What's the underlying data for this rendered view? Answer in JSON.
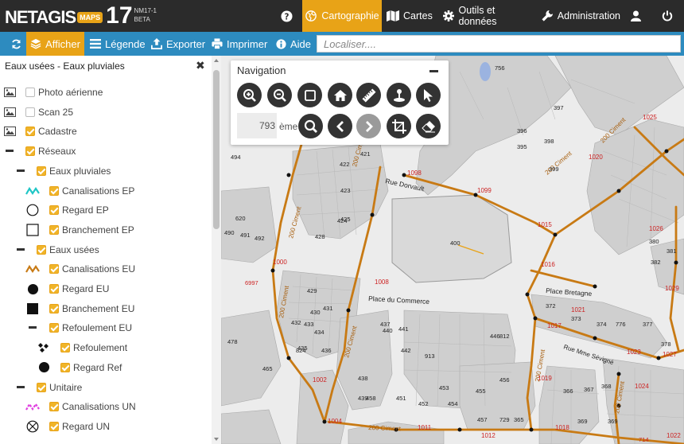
{
  "app": {
    "logo_text": "NETAGIS",
    "logo_badge": "MAPS",
    "logo_version": "17",
    "build": "NM17-1",
    "beta": "BETA"
  },
  "topnav": {
    "help_icon": "question-circle-icon",
    "cartographie": "Cartographie",
    "cartes": "Cartes",
    "outils": "Outils et données",
    "administration": "Administration",
    "user_icon": "user-icon",
    "power_icon": "power-icon"
  },
  "toolbar": {
    "afficher": "Afficher",
    "legende": "Légende",
    "exporter": "Exporter",
    "imprimer": "Imprimer",
    "aide": "Aide",
    "search_placeholder": "Localiser...."
  },
  "sidebar": {
    "title": "Eaux usées - Eaux pluviales",
    "items": [
      {
        "label": "Photo aérienne",
        "checked": false,
        "level": 0,
        "symbol": "image-icon"
      },
      {
        "label": "Scan 25",
        "checked": false,
        "level": 0,
        "symbol": "image-icon"
      },
      {
        "label": "Cadastre",
        "checked": true,
        "level": 0,
        "symbol": "image-icon"
      },
      {
        "label": "Réseaux",
        "checked": true,
        "level": 0,
        "symbol": "collapse-icon"
      },
      {
        "label": "Eaux pluviales",
        "checked": true,
        "level": 1,
        "symbol": "collapse-icon"
      },
      {
        "label": "Canalisations EP",
        "checked": true,
        "level": 2,
        "symbol": "cyan-line-icon"
      },
      {
        "label": "Regard EP",
        "checked": true,
        "level": 2,
        "symbol": "circle-outline-icon"
      },
      {
        "label": "Branchement EP",
        "checked": true,
        "level": 2,
        "symbol": "square-outline-icon"
      },
      {
        "label": "Eaux usées",
        "checked": true,
        "level": 1,
        "symbol": "collapse-icon"
      },
      {
        "label": "Canalisations EU",
        "checked": true,
        "level": 2,
        "symbol": "orange-line-icon"
      },
      {
        "label": "Regard EU",
        "checked": true,
        "level": 2,
        "symbol": "circle-filled-icon"
      },
      {
        "label": "Branchement EU",
        "checked": true,
        "level": 2,
        "symbol": "square-filled-icon"
      },
      {
        "label": "Refoulement EU",
        "checked": true,
        "level": 2,
        "symbol": "collapse-icon"
      },
      {
        "label": "Refoulement",
        "checked": true,
        "level": 3,
        "symbol": "diamonds-icon"
      },
      {
        "label": "Regard Ref",
        "checked": true,
        "level": 3,
        "symbol": "circle-filled-icon"
      },
      {
        "label": "Unitaire",
        "checked": true,
        "level": 1,
        "symbol": "collapse-icon"
      },
      {
        "label": "Canalisations UN",
        "checked": true,
        "level": 2,
        "symbol": "magenta-line-icon"
      },
      {
        "label": "Regard UN",
        "checked": true,
        "level": 2,
        "symbol": "circle-x-icon"
      }
    ]
  },
  "navigation": {
    "title": "Navigation",
    "scale_value": "793",
    "scale_unit": "ème",
    "buttons_row1": [
      "zoom-in-icon",
      "zoom-out-icon",
      "zoom-box-icon",
      "home-icon",
      "measure-icon",
      "locate-icon",
      "pointer-icon"
    ],
    "buttons_row2": [
      "scale-search-icon",
      "previous-icon",
      "next-icon",
      "crop-icon",
      "eraser-icon"
    ]
  },
  "map": {
    "streets": [
      "Rue Dorvault",
      "Place du Commerce",
      "Place Bretagne",
      "Rue Mme Sévigné"
    ],
    "pipe_labels": [
      "200 Ciment",
      "200 Ciment",
      "200 Ciment",
      "200 Ciment",
      "200 Ciment",
      "200 Ciment",
      "200 Ciment",
      "200 Ciment",
      "200 Ciment"
    ],
    "node_labels": [
      "1098",
      "1099",
      "1025",
      "1020",
      "1015",
      "1026",
      "1016",
      "1000",
      "1008",
      "1017",
      "1023",
      "1027",
      "1002",
      "1004",
      "1011",
      "1012",
      "1018",
      "1024",
      "1029",
      "1021",
      "1019",
      "1022"
    ],
    "parcel_labels": [
      "756",
      "397",
      "396",
      "395",
      "398",
      "399",
      "494",
      "421",
      "422",
      "423",
      "424",
      "425",
      "620",
      "490",
      "491",
      "492",
      "400",
      "380",
      "381",
      "382",
      "428",
      "429",
      "430",
      "431",
      "432",
      "433",
      "434",
      "435",
      "436",
      "437",
      "440",
      "441",
      "442",
      "913",
      "446",
      "812",
      "372",
      "373",
      "374",
      "776",
      "377",
      "378",
      "478",
      "465",
      "438",
      "439",
      "458",
      "451",
      "452",
      "453",
      "454",
      "455",
      "456",
      "457",
      "729",
      "365",
      "366",
      "367",
      "368",
      "369",
      "369",
      "824"
    ],
    "other_labels": [
      "6997",
      "714"
    ]
  },
  "colors": {
    "topbar": "#2b2b2b",
    "accent": "#e8a317",
    "toolbar": "#2d8bbf",
    "pipe": "#c87a14",
    "node_label": "#cc2222"
  }
}
